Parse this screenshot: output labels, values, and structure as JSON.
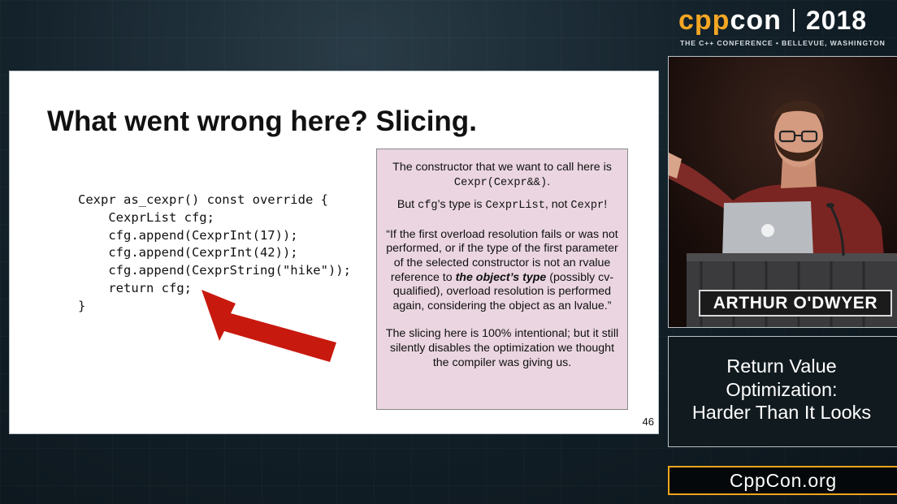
{
  "conference": {
    "logo_cpp": "cpp",
    "logo_con": "con",
    "year": "2018",
    "tagline": "THE C++ CONFERENCE • BELLEVUE, WASHINGTON",
    "website": "CppCon.org"
  },
  "slide": {
    "title": "What went wrong here? Slicing.",
    "code_lines": [
      "Cexpr as_cexpr() const override {",
      "    CexprList cfg;",
      "    cfg.append(CexprInt(17));",
      "    cfg.append(CexprInt(42));",
      "    cfg.append(CexprString(\"hike\"));",
      "    return cfg;",
      "}"
    ],
    "note": {
      "p1_text": "The constructor that we want to call here is",
      "p1_code": "Cexpr(Cexpr&&)",
      "p1_end": ".",
      "p2_a": "But",
      "p2_code1": "cfg",
      "p2_b": "’s type is",
      "p2_code2": "CexprList",
      "p2_c": ", not",
      "p2_code3": "Cexpr",
      "p2_d": "!",
      "quote_a": "“If the first overload resolution fails or was not performed, or if the type of the first parameter of the selected constructor is not an rvalue reference to",
      "quote_bold": "the object’s type",
      "quote_b": "(possibly cv-qualified), overload resolution is performed again, considering the object as an lvalue.”",
      "p4": "The slicing here is 100% intentional; but it still silently disables the optimization we thought the compiler was giving us."
    },
    "page_number": "46",
    "arrow_color": "#c8190f"
  },
  "speaker": {
    "name": "ARTHUR O'DWYER"
  },
  "talk": {
    "title_lines": [
      "Return Value",
      "Optimization:",
      "Harder Than It Looks"
    ]
  },
  "colors": {
    "accent_orange": "#f5a623",
    "note_background": "#ead5e0"
  }
}
